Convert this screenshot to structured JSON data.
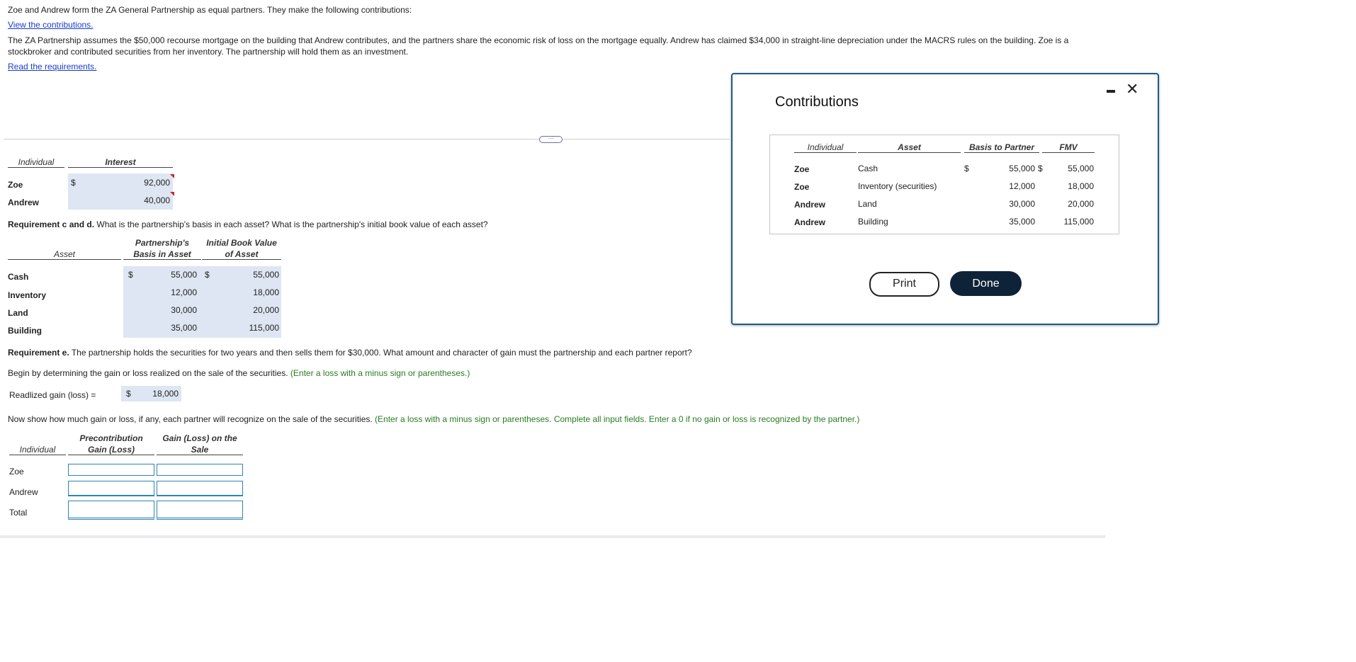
{
  "intro": {
    "line1": "Zoe and Andrew form the ZA General Partnership as equal partners. They make the following contributions:",
    "view_link": "View the contributions.",
    "line2": "The ZA Partnership assumes the $50,000 recourse mortgage on the building that Andrew contributes, and the partners share the economic risk of loss on the mortgage equally. Andrew has claimed $34,000 in straight-line depreciation under the MACRS rules on the building. Zoe is a stockbroker and contributed securities from her inventory. The partnership will hold them as an investment.",
    "req_link": "Read the requirements."
  },
  "interest_table": {
    "headers": {
      "individual": "Individual",
      "interest": "Interest"
    },
    "currency": "$",
    "rows": [
      {
        "name": "Zoe",
        "value": "92,000"
      },
      {
        "name": "Andrew",
        "value": "40,000"
      }
    ]
  },
  "req_cd": {
    "label": "Requirement c and d.",
    "question": " What is the partnership's basis in each asset? What is the partnership's initial book value of each asset?",
    "headers": {
      "asset": "Asset",
      "basis_l1": "Partnership's",
      "basis_l2": "Basis in Asset",
      "book_l1": "Initial Book Value",
      "book_l2": "of Asset"
    },
    "currency": "$",
    "rows": [
      {
        "asset": "Cash",
        "basis": "55,000",
        "book": "55,000"
      },
      {
        "asset": "Inventory",
        "basis": "12,000",
        "book": "18,000"
      },
      {
        "asset": "Land",
        "basis": "30,000",
        "book": "20,000"
      },
      {
        "asset": "Building",
        "basis": "35,000",
        "book": "115,000"
      }
    ]
  },
  "req_e": {
    "label": "Requirement e.",
    "question": " The partnership holds the securities for two years and then sells them for $30,000. What amount and character of  gain must the partnership and each partner report?",
    "begin_text": "Begin by determining the gain or loss realized on the sale of the securities.",
    "begin_hint": " (Enter a loss with a minus sign or parentheses.)",
    "realized_label": "Readlized gain (loss) =",
    "realized_currency": "$",
    "realized_value": "18,000",
    "now_text": "Now show how much gain or loss, if any, each partner will recognize on the sale of the securities.",
    "now_hint": " (Enter a loss with a minus sign or parentheses. Complete all input fields. Enter a 0 if no gain or loss is recognized by the partner.)",
    "headers": {
      "individual": "Individual",
      "pre_l1": "Precontribution",
      "pre_l2": "Gain (Loss)",
      "sale_l1": "Gain (Loss) on the",
      "sale_l2": "Sale"
    },
    "rows": [
      {
        "name": "Zoe"
      },
      {
        "name": "Andrew"
      },
      {
        "name": "Total"
      }
    ]
  },
  "dialog": {
    "title": "Contributions",
    "headers": {
      "individual": "Individual",
      "asset": "Asset",
      "basis": "Basis to Partner",
      "fmv": "FMV"
    },
    "currency": "$",
    "rows": [
      {
        "individual": "Zoe",
        "asset": "Cash",
        "basis": "55,000",
        "fmv": "55,000"
      },
      {
        "individual": "Zoe",
        "asset": "Inventory (securities)",
        "basis": "12,000",
        "fmv": "18,000"
      },
      {
        "individual": "Andrew",
        "asset": "Land",
        "basis": "30,000",
        "fmv": "20,000"
      },
      {
        "individual": "Andrew",
        "asset": "Building",
        "basis": "35,000",
        "fmv": "115,000"
      }
    ],
    "print_label": "Print",
    "done_label": "Done",
    "handle_glyph": "···",
    "close_glyph": "✕",
    "colors": {
      "border": "#1d5c8a",
      "done_bg": "#0f2338",
      "input_border": "#2c84b7",
      "shade": "#dde6f2",
      "hint": "#2a7a22",
      "link": "#1a3cc9"
    }
  }
}
